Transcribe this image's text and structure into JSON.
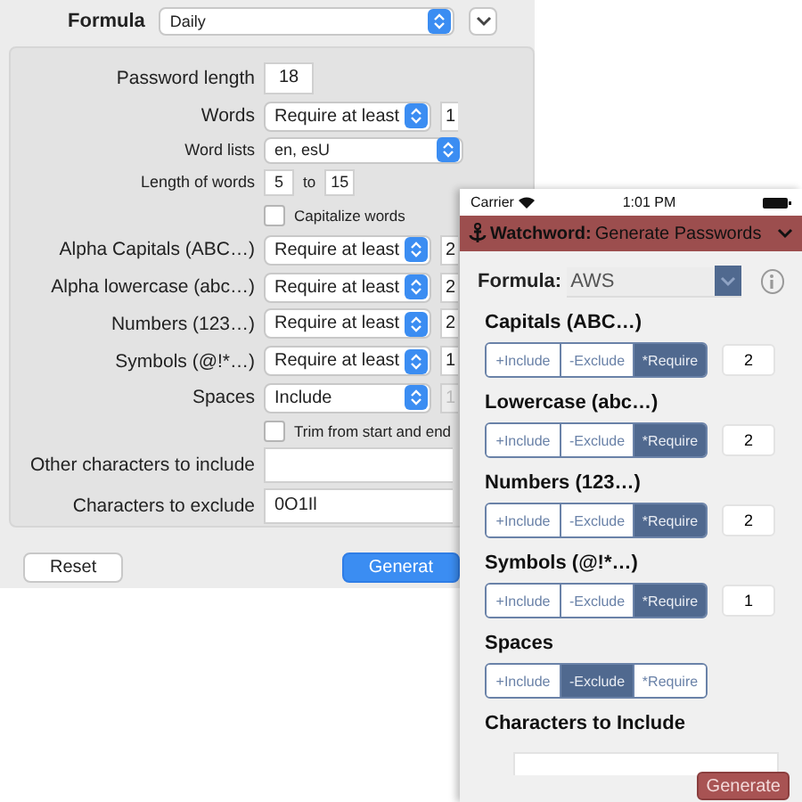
{
  "dialog": {
    "formula": {
      "label": "Formula",
      "value": "Daily"
    },
    "rows": [
      {
        "kind": "number",
        "label": "Password length",
        "value": "18"
      },
      {
        "kind": "rule",
        "label": "Words",
        "option": "Require at least",
        "count": "1",
        "disabled": false
      },
      {
        "kind": "list",
        "label": "Word lists",
        "value": "en, esU"
      },
      {
        "kind": "range",
        "label": "Length of words",
        "from": "5",
        "joiner": "to",
        "to": "15"
      },
      {
        "kind": "checkbox",
        "label": "Capitalize words",
        "checked": false
      },
      {
        "kind": "rule",
        "label": "Alpha Capitals (ABC…)",
        "option": "Require at least",
        "count": "2",
        "disabled": false
      },
      {
        "kind": "rule",
        "label": "Alpha lowercase (abc…)",
        "option": "Require at least",
        "count": "2",
        "disabled": false
      },
      {
        "kind": "rule",
        "label": "Numbers (123…)",
        "option": "Require at least",
        "count": "2",
        "disabled": false
      },
      {
        "kind": "rule",
        "label": "Symbols (@!*…)",
        "option": "Require at least",
        "count": "1",
        "disabled": false
      },
      {
        "kind": "rule",
        "label": "Spaces",
        "option": "Include",
        "count": "1",
        "disabled": true
      },
      {
        "kind": "checkbox",
        "label": "Trim from start and end",
        "checked": false
      },
      {
        "kind": "text",
        "label": "Other characters to include"
      },
      {
        "kind": "text",
        "label": "Characters to exclude",
        "value": "0O1Il"
      }
    ],
    "buttons": [
      {
        "kind": "plain",
        "label": "Reset"
      },
      {
        "kind": "default",
        "label": "Generat"
      }
    ]
  },
  "phone": {
    "status": {
      "carrier": "Carrier",
      "time": "1:01 PM"
    },
    "header": {
      "app": "Watchword:",
      "title": "Generate Passwords"
    },
    "formula": {
      "label": "Formula:",
      "value": "AWS"
    },
    "sections": [
      {
        "title": "Capitals (ABC…)",
        "options": [
          {
            "label": "+Include",
            "selected": false
          },
          {
            "label": "-Exclude",
            "selected": false
          },
          {
            "label": "*Require",
            "selected": true
          }
        ],
        "count": "2"
      },
      {
        "title": "Lowercase (abc…)",
        "options": [
          {
            "label": "+Include",
            "selected": false
          },
          {
            "label": "-Exclude",
            "selected": false
          },
          {
            "label": "*Require",
            "selected": true
          }
        ],
        "count": "2"
      },
      {
        "title": "Numbers (123…)",
        "options": [
          {
            "label": "+Include",
            "selected": false
          },
          {
            "label": "-Exclude",
            "selected": false
          },
          {
            "label": "*Require",
            "selected": true
          }
        ],
        "count": "2"
      },
      {
        "title": "Symbols (@!*…)",
        "options": [
          {
            "label": "+Include",
            "selected": false
          },
          {
            "label": "-Exclude",
            "selected": false
          },
          {
            "label": "*Require",
            "selected": true
          }
        ],
        "count": "1"
      },
      {
        "title": "Spaces",
        "options": [
          {
            "label": "+Include",
            "selected": false
          },
          {
            "label": "-Exclude",
            "selected": true
          },
          {
            "label": "*Require",
            "selected": false
          }
        ]
      }
    ],
    "include": {
      "title": "Characters to Include"
    },
    "generate": "Generate"
  }
}
